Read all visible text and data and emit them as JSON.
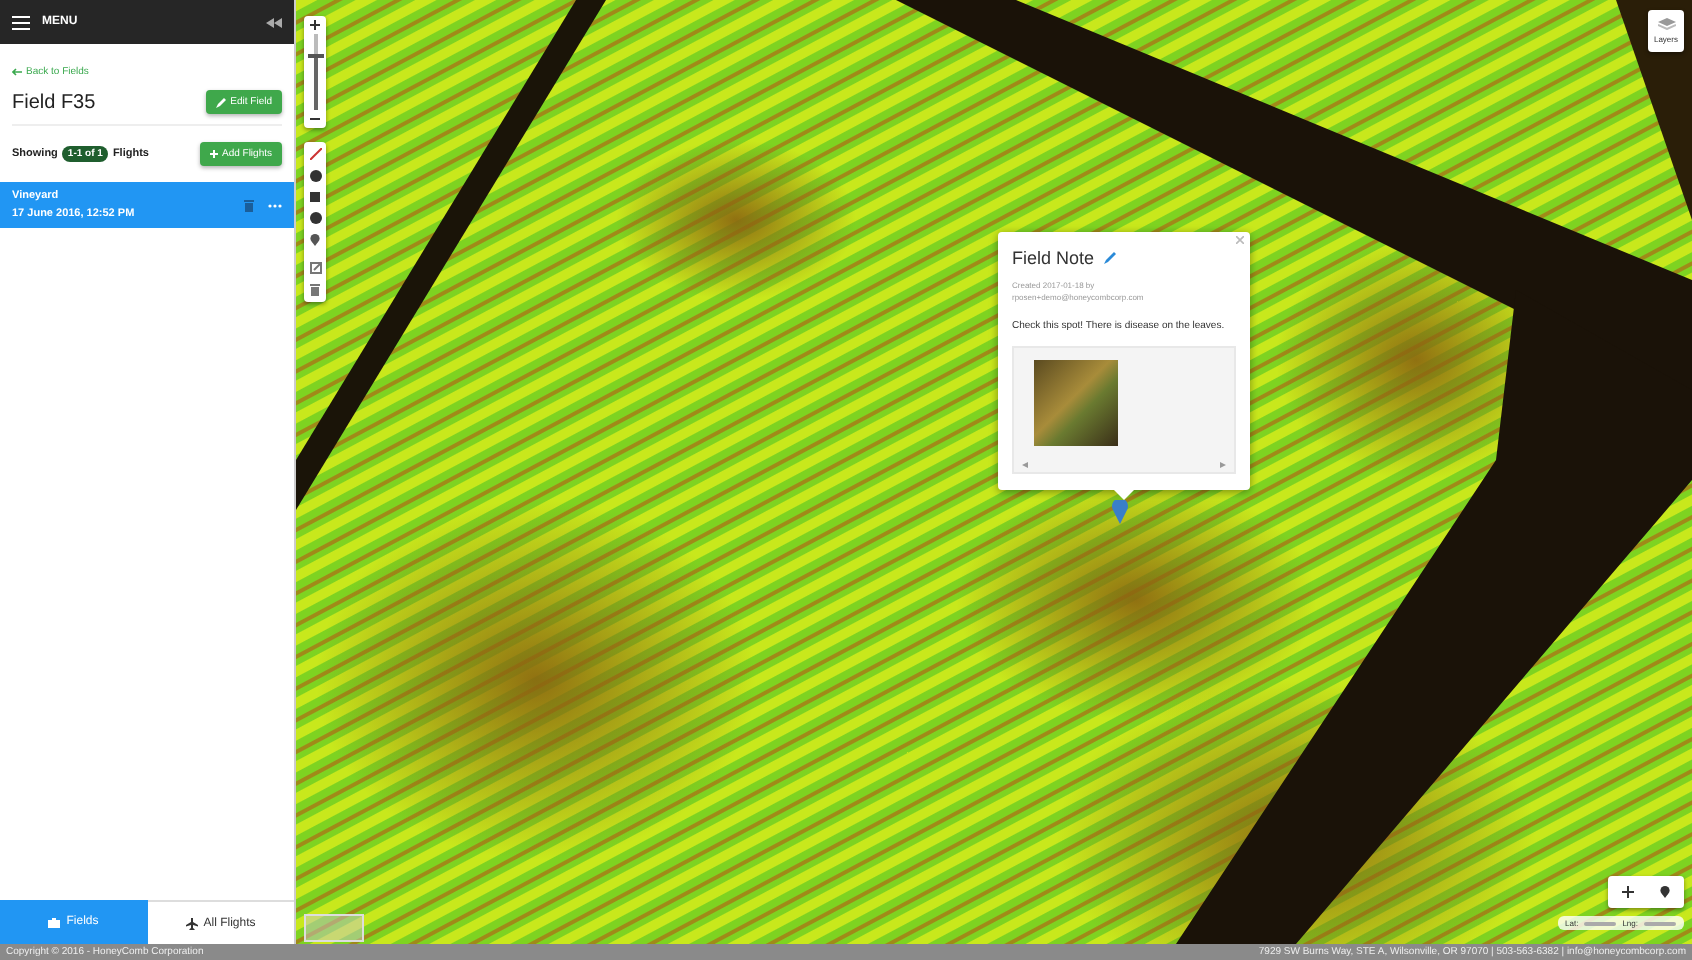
{
  "header": {
    "menu_label": "MENU"
  },
  "sidebar": {
    "back_link": "Back to Fields",
    "field_title": "Field F35",
    "edit_button": "Edit Field",
    "showing_label": "Showing",
    "count_badge": "1-1 of 1",
    "flights_label": "Flights",
    "add_button": "Add Flights",
    "flights": [
      {
        "name": "Vineyard",
        "date": "17 June 2016, 12:52 PM",
        "selected": true
      }
    ],
    "bottom_tabs": [
      {
        "label": "Fields",
        "kind": "fields",
        "selected": true
      },
      {
        "label": "All Flights",
        "kind": "flights",
        "selected": false
      }
    ]
  },
  "map": {
    "zoom": {
      "level": 0.7
    },
    "layers_button": "Layers",
    "lat_label": "Lat:",
    "lng_label": "Lng:"
  },
  "note": {
    "title": "Field Note",
    "created": "Created 2017-01-18 by",
    "author": "rposen+demo@honeycombcorp.com",
    "text": "Check this spot! There is disease on the leaves."
  },
  "footer": {
    "copyright": "Copyright © 2016 - HoneyComb Corporation",
    "contact": "7929 SW Burns Way, STE A, Wilsonville, OR 97070 | 503-563-6382 | info@honeycombcorp.com"
  }
}
